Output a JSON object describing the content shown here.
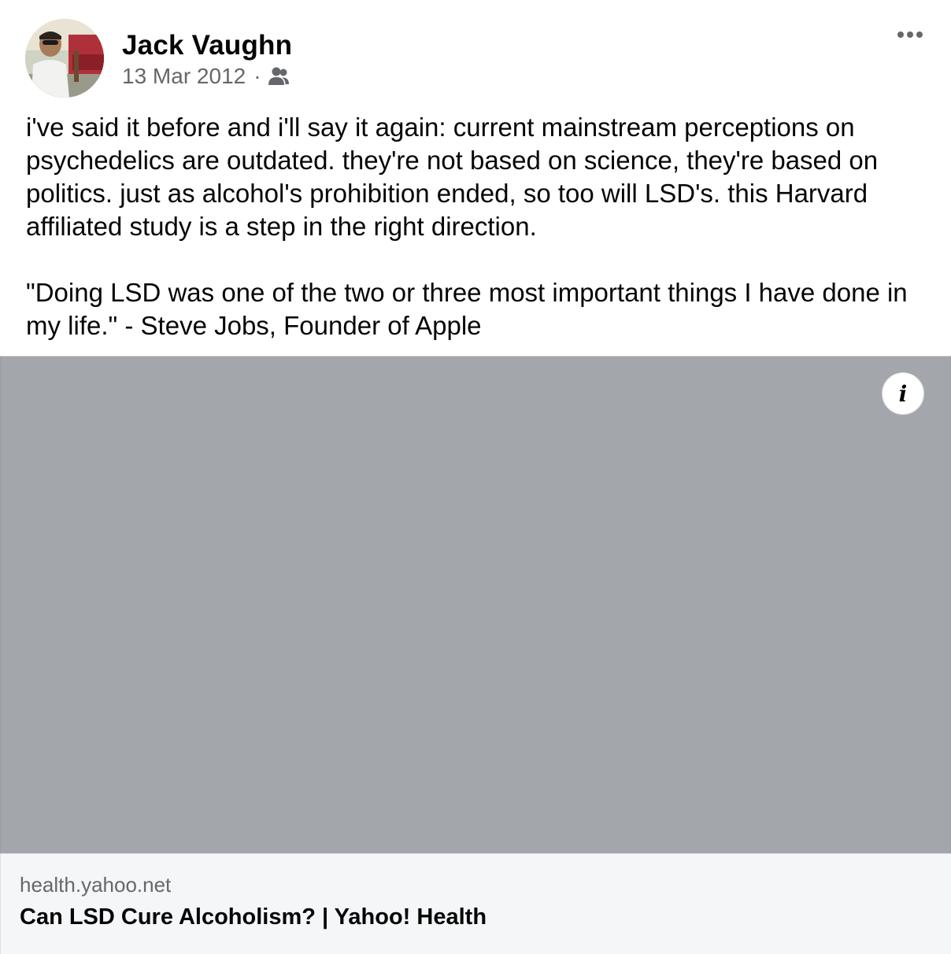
{
  "post": {
    "author": {
      "name": "Jack Vaughn",
      "avatar_icon": "profile-photo"
    },
    "meta": {
      "date": "13 Mar 2012",
      "separator": "·",
      "audience_icon": "friends-icon"
    },
    "more_icon": "more-options-icon",
    "text": "i've said it before and i'll say it again: current mainstream perceptions on psychedelics are outdated. they're not based on science, they're based on politics. just as alcohol's prohibition ended, so too will LSD's. this Harvard affiliated study is a step in the right direction.\n\n\"Doing LSD was one of the two or three most important things I have done in my life.\" - Steve Jobs, Founder of Apple",
    "link_preview": {
      "info_label": "i",
      "domain": "health.yahoo.net",
      "title": "Can LSD Cure Alcoholism? | Yahoo! Health",
      "image_color": "#a3a6ab"
    }
  }
}
